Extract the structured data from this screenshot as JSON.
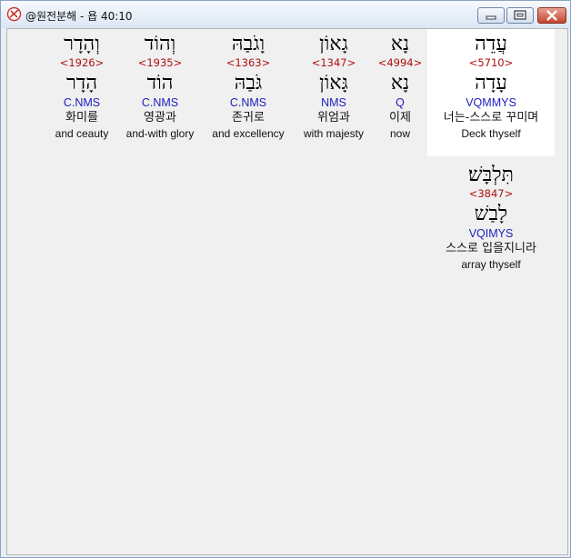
{
  "window": {
    "title": "@원전분해 - 욥 40:10"
  },
  "words": [
    {
      "hebrew": "עֲדֵה",
      "strong": "<5710>",
      "root": "עָדָה",
      "morph": "VQMMYS",
      "korean": "너는-스스로 꾸미며",
      "english": "Deck thyself"
    },
    {
      "hebrew": "נָא",
      "strong": "<4994>",
      "root": "נָא",
      "morph": "Q",
      "korean": "이제",
      "english": "now"
    },
    {
      "hebrew": "גָאוֹן",
      "strong": "<1347>",
      "root": "גָּאוֹן",
      "morph": "NMS",
      "korean": "위엄과",
      "english": "with majesty"
    },
    {
      "hebrew": "וָגֹבַהּ",
      "strong": "<1363>",
      "root": "גֹּבַהּ",
      "morph": "C.NMS",
      "korean": "존귀로",
      "english": "and excellency"
    },
    {
      "hebrew": "וְהוֹד",
      "strong": "<1935>",
      "root": "הוֹד",
      "morph": "C.NMS",
      "korean": "영광과",
      "english": "and-with glory"
    },
    {
      "hebrew": "וְהָדָר",
      "strong": "<1926>",
      "root": "הָדָר",
      "morph": "C.NMS",
      "korean": "화미를",
      "english": "and ceauty"
    },
    {
      "hebrew": "תִּלְבָּשׁ׃",
      "strong": "<3847>",
      "root": "לָבַשׁ",
      "morph": "VQIMYS",
      "korean": "스스로 입을지니라",
      "english": "array thyself"
    }
  ]
}
